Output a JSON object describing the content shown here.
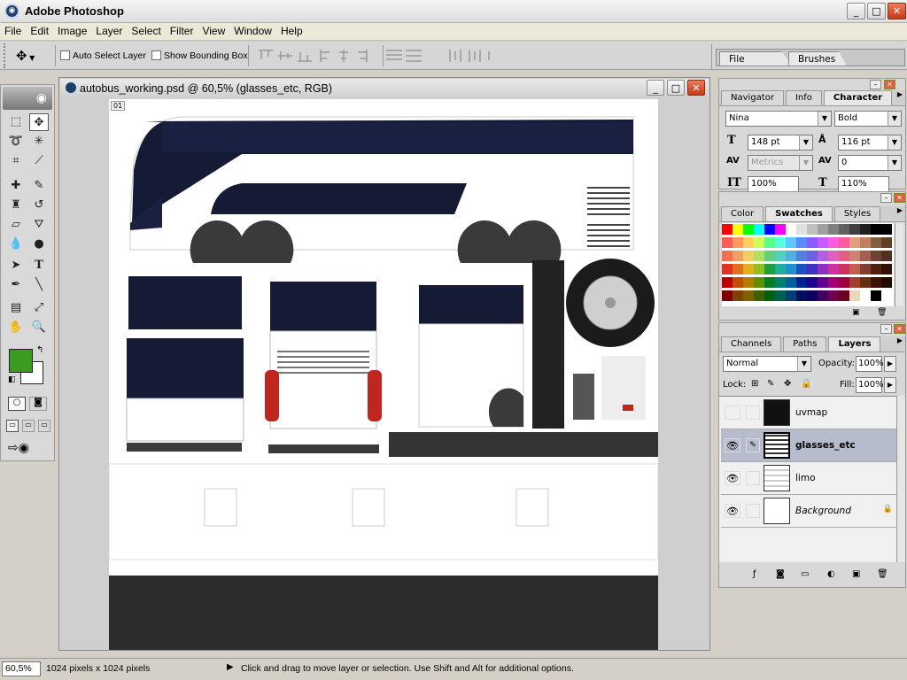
{
  "app": {
    "title": "Adobe Photoshop",
    "icon": "photoshop-eye-icon"
  },
  "window_controls": {
    "minimize": "_",
    "maximize": "□",
    "close": "✕"
  },
  "menu": [
    "File",
    "Edit",
    "Image",
    "Layer",
    "Select",
    "Filter",
    "View",
    "Window",
    "Help"
  ],
  "options": {
    "tool_icon": "move-tool-icon",
    "auto_select_layer": {
      "label": "Auto Select Layer",
      "checked": false
    },
    "show_bounding_box": {
      "label": "Show Bounding Box",
      "checked": false
    }
  },
  "palette_well": {
    "tabs": [
      "File Browser",
      "Brushes"
    ]
  },
  "document": {
    "title": "autobus_working.psd @ 60,5% (glasses_etc, RGB)",
    "ruler_marks": [
      "01"
    ]
  },
  "character_panel": {
    "tabs": [
      "Navigator",
      "Info",
      "Character"
    ],
    "active_tab": "Character",
    "font": "Nina",
    "style": "Bold",
    "size": "148 pt",
    "leading": "116 pt",
    "kerning": "Metrics",
    "tracking": "0",
    "vertical_scale": "100%",
    "horizontal_scale": "110%"
  },
  "swatches_panel": {
    "tabs": [
      "Color",
      "Swatches",
      "Styles"
    ],
    "active_tab": "Swatches",
    "colors": {
      "row1": [
        "#ff0000",
        "#ffff00",
        "#00ff00",
        "#00ffff",
        "#0000ff",
        "#ff00ff",
        "#ffffff",
        "#e0e0e0",
        "#c0c0c0",
        "#a0a0a0",
        "#808080",
        "#606060",
        "#404040",
        "#202020",
        "#000000",
        "#000000"
      ],
      "row2": [
        "#ff5a5a",
        "#ff9a5a",
        "#ffd05a",
        "#c8ff5a",
        "#5aff8a",
        "#5affe0",
        "#5ac8ff",
        "#5a8aff",
        "#8a5aff",
        "#c85aff",
        "#ff5ae0",
        "#ff5a9a",
        "#e0a080",
        "#c08060",
        "#806040",
        "#604020"
      ],
      "row3": [
        "#f07050",
        "#f0a060",
        "#f0d060",
        "#b0e060",
        "#60d080",
        "#50d0c0",
        "#50b0e0",
        "#5080e0",
        "#7060e0",
        "#b060e0",
        "#e060c0",
        "#e06080",
        "#d08070",
        "#a06050",
        "#704030",
        "#503020"
      ],
      "row4": [
        "#e03020",
        "#e07020",
        "#e0b020",
        "#90c020",
        "#20a040",
        "#20b0a0",
        "#2090d0",
        "#2050c0",
        "#4030c0",
        "#9030c0",
        "#d030a0",
        "#d03060",
        "#c06050",
        "#804030",
        "#502010",
        "#301000"
      ],
      "row5": [
        "#c00000",
        "#c05000",
        "#b08000",
        "#609000",
        "#008020",
        "#008070",
        "#0060a0",
        "#002090",
        "#200090",
        "#600090",
        "#a00070",
        "#a00040",
        "#a04030",
        "#603010",
        "#401000",
        "#200800"
      ],
      "row6": [
        "#800000",
        "#804000",
        "#806000",
        "#406000",
        "#006010",
        "#006050",
        "#004070",
        "#001060",
        "#100060",
        "#400060",
        "#700050",
        "#700020",
        "#e8d8b8",
        "#ffffff",
        "#000000",
        "#ffffff"
      ]
    }
  },
  "layers_panel": {
    "tabs": [
      "Channels",
      "Paths",
      "Layers"
    ],
    "active_tab": "Layers",
    "blend_mode": "Normal",
    "opacity_label": "Opacity:",
    "opacity": "100%",
    "lock_label": "Lock:",
    "fill_label": "Fill:",
    "fill": "100%",
    "layers": [
      {
        "name": "uvmap",
        "visible": false,
        "selected": false,
        "locked": false,
        "italic": false
      },
      {
        "name": "glasses_etc",
        "visible": true,
        "selected": true,
        "locked": false,
        "italic": false
      },
      {
        "name": "limo",
        "visible": true,
        "selected": false,
        "locked": false,
        "italic": false
      },
      {
        "name": "Background",
        "visible": true,
        "selected": false,
        "locked": true,
        "italic": true
      }
    ]
  },
  "status": {
    "zoom": "60,5%",
    "doc_size": "1024 pixels x 1024 pixels",
    "hint": "Click and drag to move layer or selection.  Use Shift and Alt for additional options."
  }
}
